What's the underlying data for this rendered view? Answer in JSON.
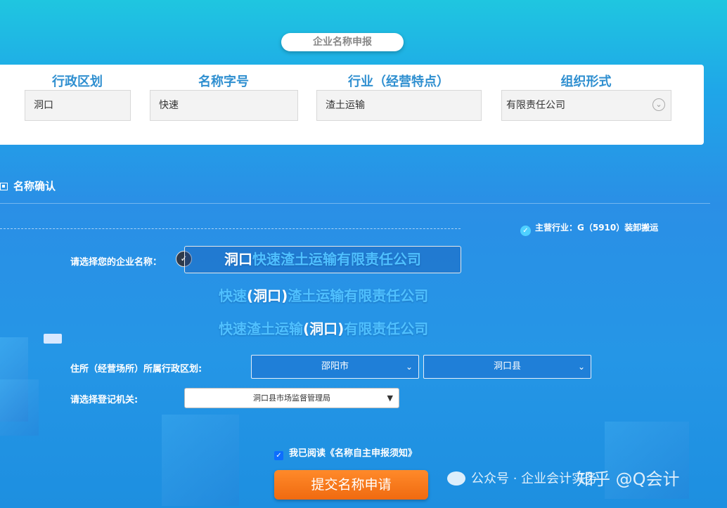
{
  "header": {
    "title": "企业名称申报"
  },
  "form": {
    "columns": [
      {
        "label": "行政区划",
        "value": "洞口"
      },
      {
        "label": "名称字号",
        "value": "快速"
      },
      {
        "label": "行业（经营特点）",
        "value": "渣土运输"
      },
      {
        "label": "组织形式",
        "value": "有限责任公司"
      }
    ]
  },
  "confirm": {
    "section_title": "名称确认",
    "main_industry": "主营行业：G（5910）装卸搬运",
    "select_name_label": "请选择您的企业名称：",
    "options": [
      {
        "pre": "",
        "highlight": "洞口",
        "post": "快速渣土运输有限责任公司"
      },
      {
        "pre": "快速",
        "highlight": "(洞口)",
        "post": "渣土运输有限责任公司"
      },
      {
        "pre": "快速渣土运输",
        "highlight": "(洞口)",
        "post": "有限责任公司"
      }
    ],
    "address_label": "住所（经营场所）所属行政区划:",
    "city": "邵阳市",
    "county": "洞口县",
    "authority_label": "请选择登记机关:",
    "authority": "洞口县市场监督管理局",
    "agree_text": "我已阅读《名称自主申报须知》",
    "submit_label": "提交名称申请"
  },
  "watermark": {
    "left": "公众号 · 企业会计实务",
    "right": "知乎 @Q会计"
  },
  "colors": {
    "accent": "#2f8fd0",
    "submit": "#f47a1c",
    "bg": "#2596e6"
  }
}
